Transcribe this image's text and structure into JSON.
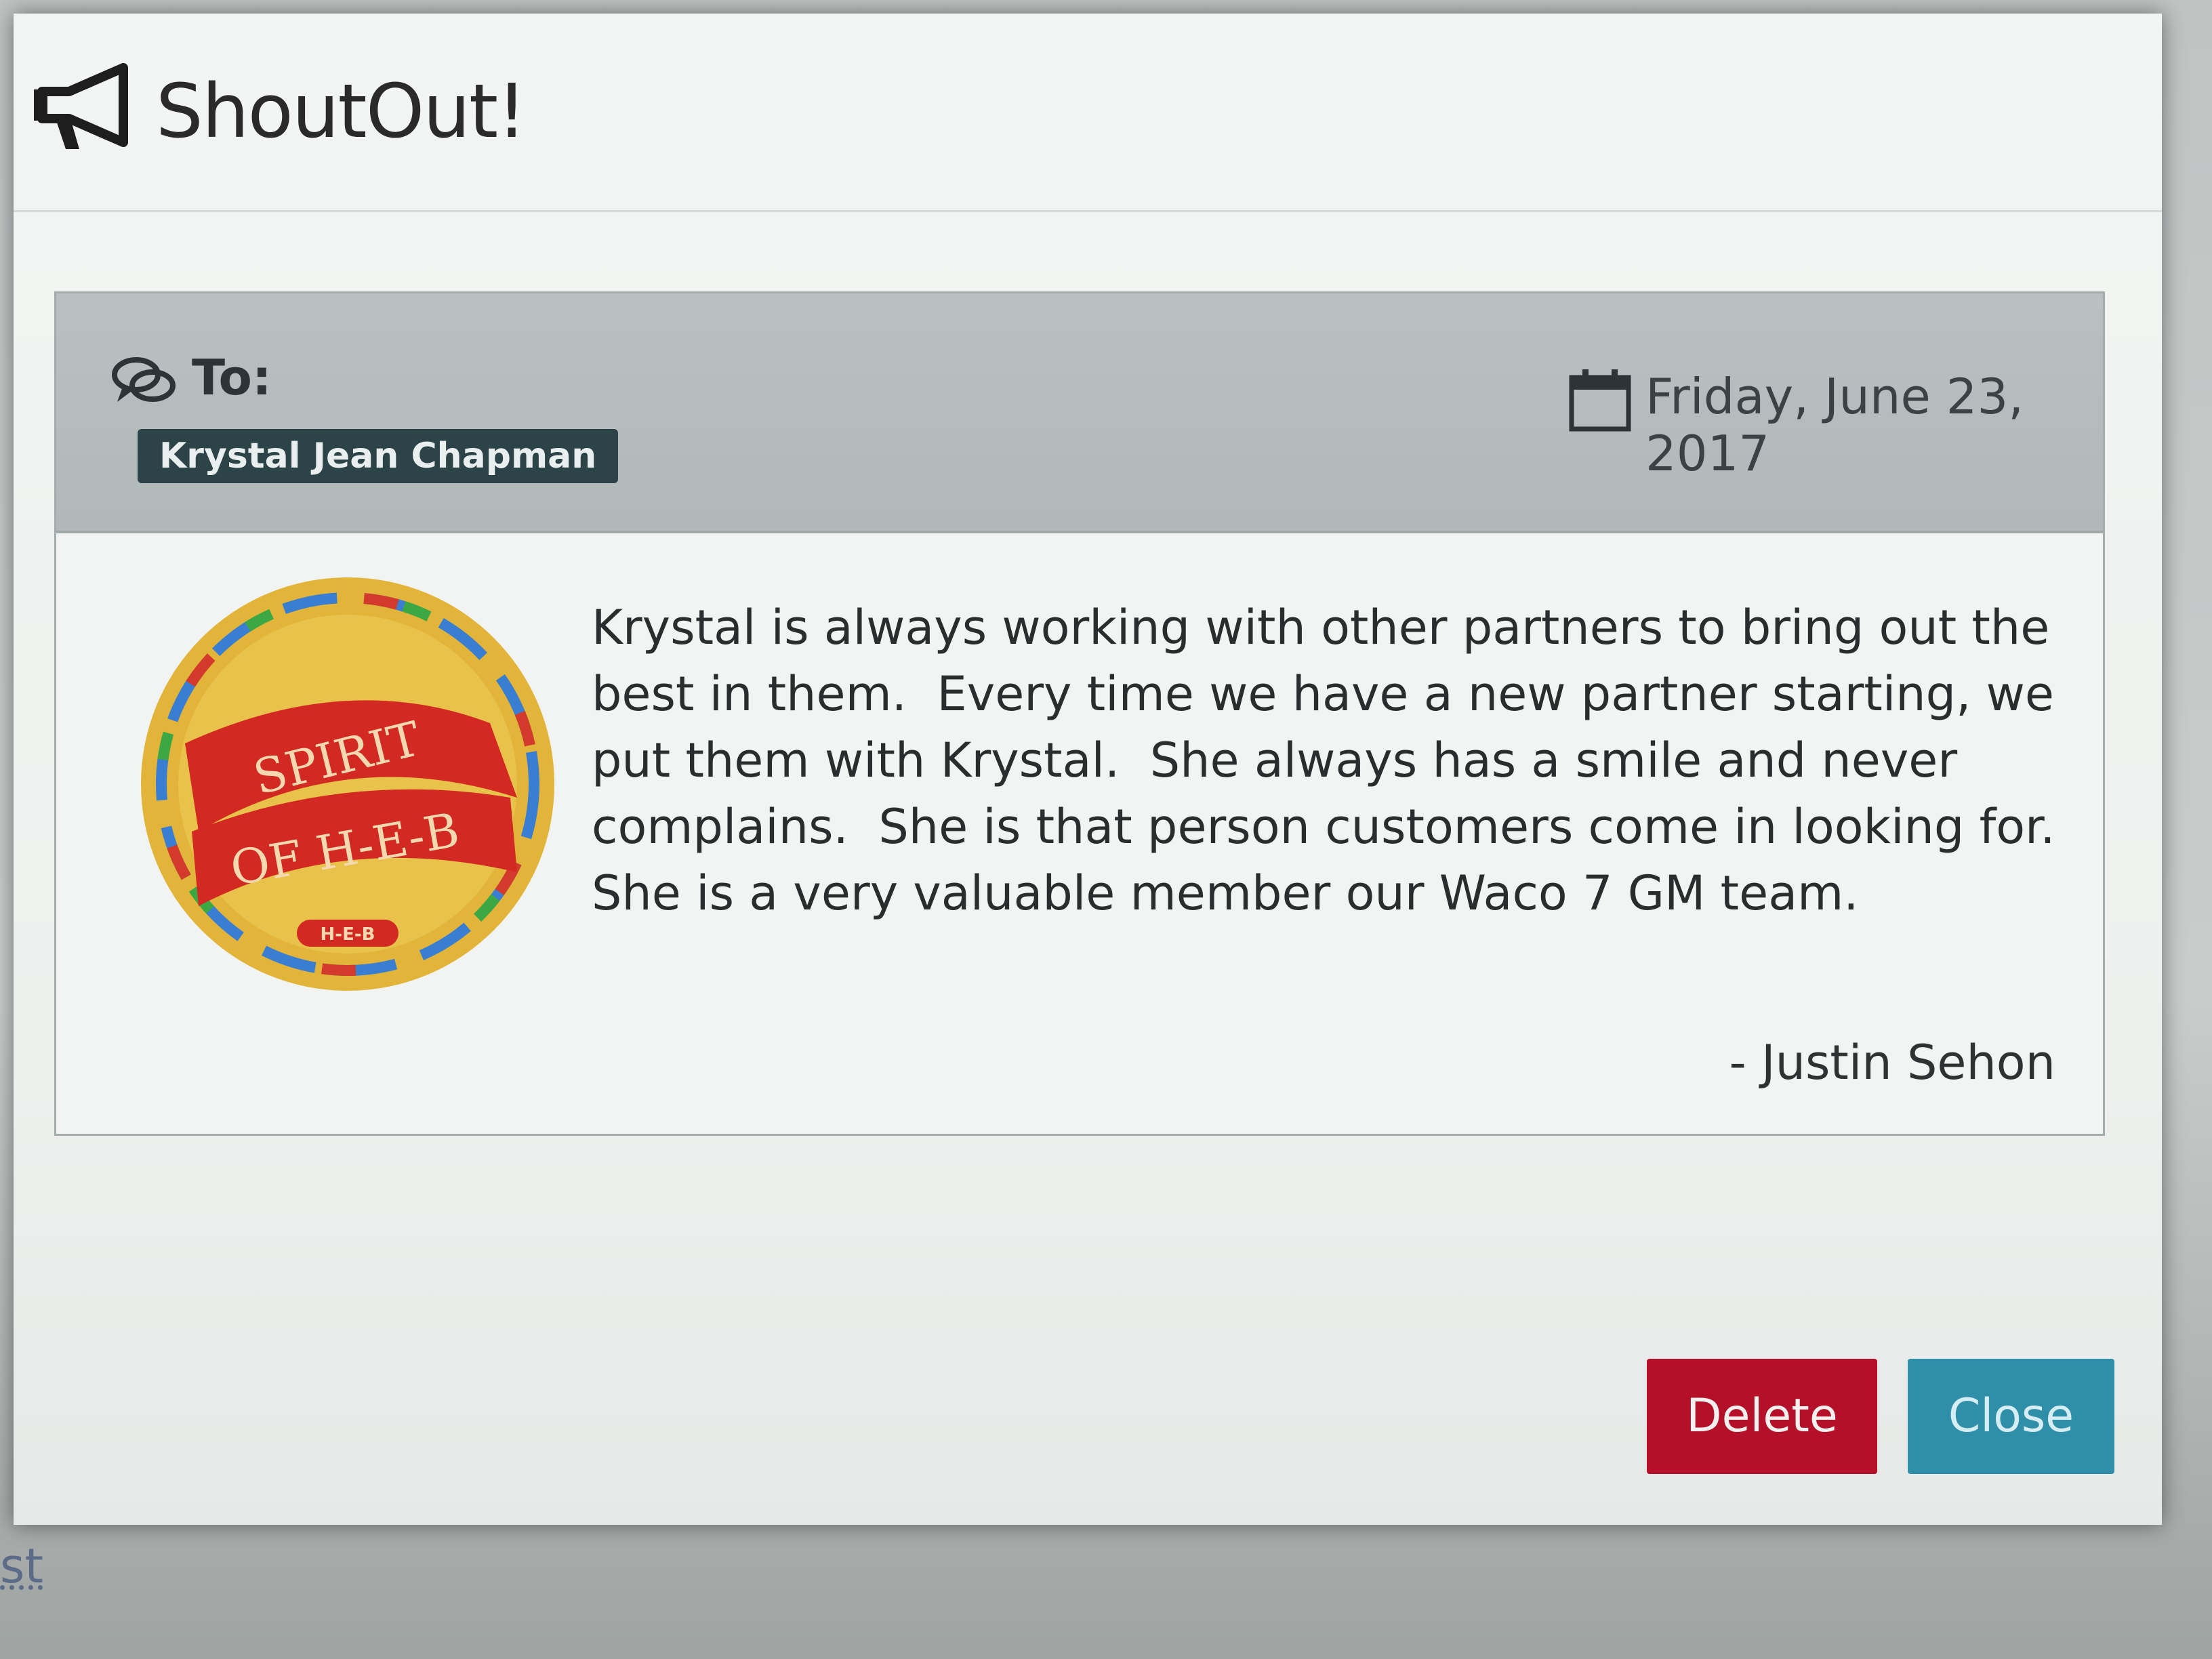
{
  "modal": {
    "title": "ShoutOut!",
    "icons": {
      "title_icon": "megaphone-icon",
      "to_icon": "comments-icon",
      "date_icon": "calendar-icon"
    }
  },
  "card": {
    "to_label": "To:",
    "recipient": "Krystal Jean Chapman",
    "date": "Friday, June 23, 2017",
    "badge": {
      "lines": [
        "SPIRIT",
        "OF H-E-B"
      ],
      "footer": "H-E-B"
    },
    "message": "Krystal is always working with other partners to bring out the best in them.  Every time we have a new partner starting, we put them with Krystal.  She always has a smile and never complains.  She is that person customers come in looking for.  She is a very valuable member our Waco 7 GM team.",
    "signature": "- Justin Sehon"
  },
  "buttons": {
    "delete_label": "Delete",
    "close_label": "Close"
  },
  "backdrop": {
    "partial_text": "st"
  },
  "colors": {
    "delete": "#b5102a",
    "close": "#2f8fa8",
    "recipient_badge": "#2c4348",
    "card_header": "#b9c0c1"
  }
}
